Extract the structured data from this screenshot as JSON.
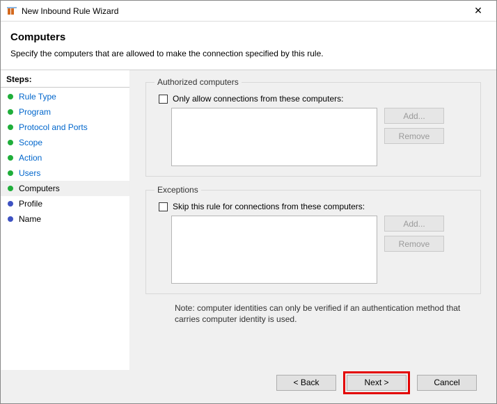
{
  "window": {
    "title": "New Inbound Rule Wizard",
    "close_glyph": "✕"
  },
  "header": {
    "title": "Computers",
    "subtitle": "Specify the computers that are allowed to make the connection specified by this rule."
  },
  "sidebar": {
    "title": "Steps:",
    "items": [
      {
        "label": "Rule Type",
        "state": "done"
      },
      {
        "label": "Program",
        "state": "done"
      },
      {
        "label": "Protocol and Ports",
        "state": "done"
      },
      {
        "label": "Scope",
        "state": "done"
      },
      {
        "label": "Action",
        "state": "done"
      },
      {
        "label": "Users",
        "state": "done"
      },
      {
        "label": "Computers",
        "state": "current"
      },
      {
        "label": "Profile",
        "state": "todo"
      },
      {
        "label": "Name",
        "state": "todo"
      }
    ]
  },
  "authorized": {
    "legend": "Authorized computers",
    "checkbox_label": "Only allow connections from these computers:",
    "add_label": "Add...",
    "remove_label": "Remove"
  },
  "exceptions": {
    "legend": "Exceptions",
    "checkbox_label": "Skip this rule for connections from these computers:",
    "add_label": "Add...",
    "remove_label": "Remove"
  },
  "note": "Note: computer identities can only be verified if an authentication method that carries computer identity is used.",
  "footer": {
    "back": "< Back",
    "next": "Next >",
    "cancel": "Cancel"
  }
}
